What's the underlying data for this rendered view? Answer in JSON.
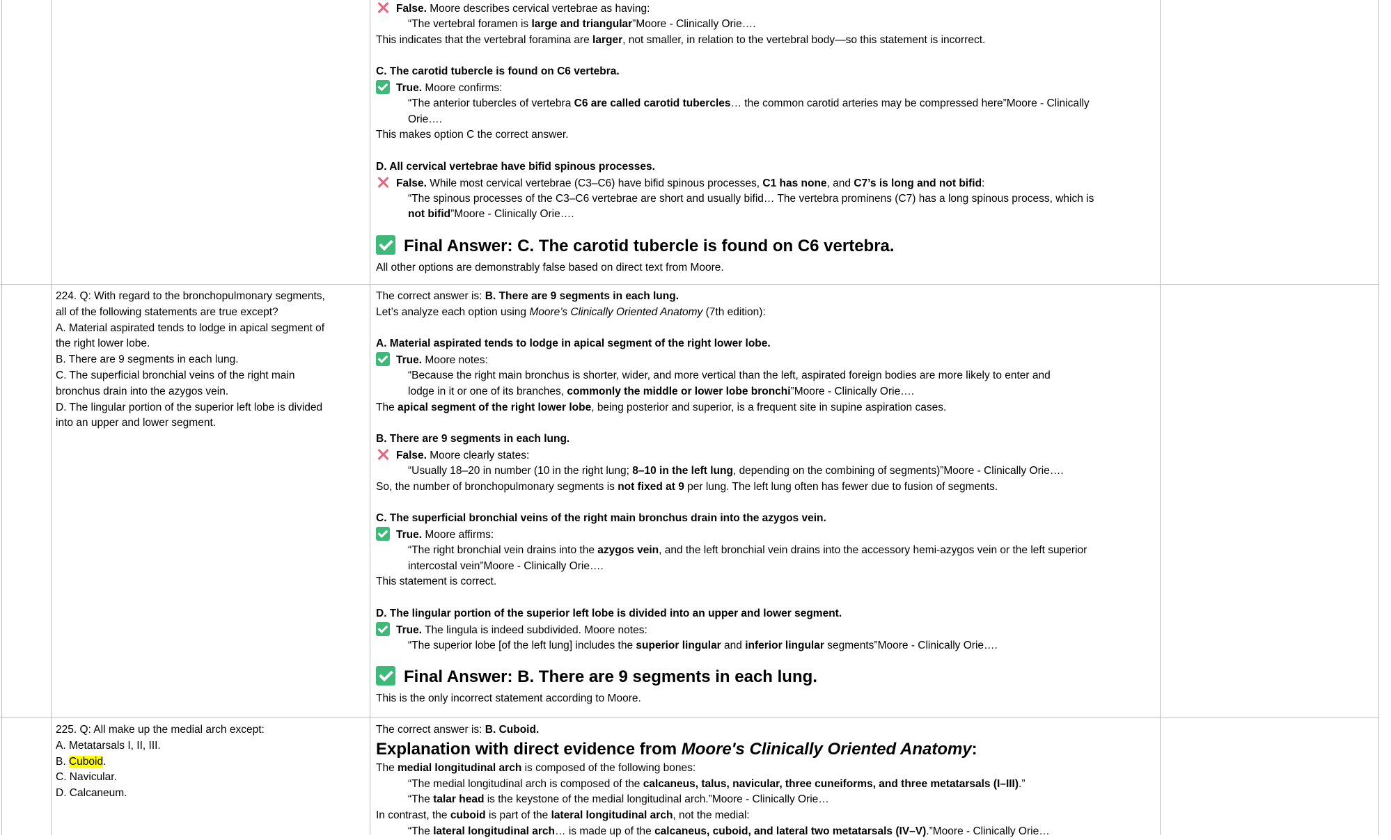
{
  "row1": {
    "d_false_prev": {
      "verdict": "False.",
      "text": " Moore describes cervical vertebrae as having:"
    },
    "quote_b_1": "“The vertebral foramen is ",
    "quote_b_2": "large and triangular",
    "quote_b_3": "”Moore - Clinically Orie….",
    "b_note_1": "This indicates that the vertebral foramina are ",
    "b_note_2": "larger",
    "b_note_3": ", not smaller, in relation to the vertebral body—so this statement is incorrect.",
    "c_head": "C. The carotid tubercle is found on C6 vertebra.",
    "c_verdict": "True.",
    "c_intro": " Moore confirms:",
    "c_quote_1": "“The anterior tubercles of vertebra ",
    "c_quote_2": "C6 are called carotid tubercles",
    "c_quote_3": "… the common carotid arteries may be compressed here”Moore - Clinically",
    "c_quote_4": "Orie….",
    "c_note": "This makes option C the correct answer.",
    "d_head": "D. All cervical vertebrae have bifid spinous processes.",
    "d_verdict": "False.",
    "d_intro_1": " While most cervical vertebrae (C3–C6) have bifid spinous processes, ",
    "d_intro_2": "C1 has none",
    "d_intro_3": ", and ",
    "d_intro_4": "C7’s is long and not bifid",
    "d_intro_5": ":",
    "d_quote_1": "“The spinous processes of the C3–C6 vertebrae are short and usually bifid… The vertebra prominens (C7) has a long spinous process, which is",
    "d_quote_2": "not bifid",
    "d_quote_3": "”Moore - Clinically Orie….",
    "final": "Final Answer: C. The carotid tubercle is found on C6 vertebra.",
    "final_note": "All other options are demonstrably false based on direct text from Moore."
  },
  "row2": {
    "question": [
      "224. Q: With regard to the bronchopulmonary segments,",
      "all of the following statements are true except?",
      "A. Material aspirated tends to lodge in apical segment of",
      "the right lower lobe.",
      "B. There are 9 segments in each lung.",
      "C. The superficial bronchial veins of the right main",
      "bronchus drain into the azygos vein.",
      "D. The lingular portion of the superior left lobe is divided",
      "into an upper and lower segment."
    ],
    "correct_1": "The correct answer is: ",
    "correct_2": "B. There are 9 segments in each lung.",
    "analyze_1": "Let’s analyze each option using ",
    "analyze_2": "Moore’s Clinically Oriented Anatomy",
    "analyze_3": " (7th edition):",
    "a_head": "A. Material aspirated tends to lodge in apical segment of the right lower lobe.",
    "a_verdict": "True.",
    "a_intro": " Moore notes:",
    "a_quote_1": "“Because the right main bronchus is shorter, wider, and more vertical than the left, aspirated foreign bodies are more likely to enter and",
    "a_quote_2": "lodge in it or one of its branches, ",
    "a_quote_3": "commonly the middle or lower lobe bronchi",
    "a_quote_4": "”Moore - Clinically Orie….",
    "a_note_1": "The ",
    "a_note_2": "apical segment of the right lower lobe",
    "a_note_3": ", being posterior and superior, is a frequent site in supine aspiration cases.",
    "b_head": "B. There are 9 segments in each lung.",
    "b_verdict": "False.",
    "b_intro": " Moore clearly states:",
    "b_quote_1": "“Usually 18–20 in number (10 in the right lung; ",
    "b_quote_2": "8–10 in the left lung",
    "b_quote_3": ", depending on the combining of segments)”Moore - Clinically Orie….",
    "b_note_1": "So, the number of bronchopulmonary segments is ",
    "b_note_2": "not fixed at 9",
    "b_note_3": " per lung. The left lung often has fewer due to fusion of segments.",
    "c_head": "C. The superficial bronchial veins of the right main bronchus drain into the azygos vein.",
    "c_verdict": "True.",
    "c_intro": " Moore affirms:",
    "c_quote_1": "“The right bronchial vein drains into the ",
    "c_quote_2": "azygos vein",
    "c_quote_3": ", and the left bronchial vein drains into the accessory hemi-azygos vein or the left superior",
    "c_quote_4": "intercostal vein”Moore - Clinically Orie….",
    "c_note": "This statement is correct.",
    "d_head": "D. The lingular portion of the superior left lobe is divided into an upper and lower segment.",
    "d_verdict": "True.",
    "d_intro": " The lingula is indeed subdivided. Moore notes:",
    "d_quote_1": "“The superior lobe [of the left lung] includes the ",
    "d_quote_2": "superior lingular",
    "d_quote_3": " and ",
    "d_quote_4": "inferior lingular",
    "d_quote_5": " segments”Moore - Clinically Orie….",
    "final": "Final Answer: B. There are 9 segments in each lung.",
    "final_note": "This is the only incorrect statement according to Moore."
  },
  "row3": {
    "q_title": "225. Q: All make up the medial arch except:",
    "q_a": "A. Metatarsals I, II, III.",
    "q_b_prefix": "B. ",
    "q_b_word": "Cuboid",
    "q_b_suffix": ".",
    "q_c": "C. Navicular.",
    "q_d": "D. Calcaneum.",
    "correct_1": "The correct answer is: ",
    "correct_2": "B. Cuboid.",
    "expl_1": "Explanation with direct evidence from ",
    "expl_2": "Moore's Clinically Oriented Anatomy",
    "expl_3": ":",
    "m_1": "The ",
    "m_2": "medial longitudinal arch",
    "m_3": " is composed of the following bones:",
    "q1_1": "“The medial longitudinal arch is composed of the ",
    "q1_2": "calcaneus, talus, navicular, three cuneiforms, and three metatarsals (I–III)",
    "q1_3": ".”",
    "q2_1": "“The ",
    "q2_2": "talar head",
    "q2_3": " is the keystone of the medial longitudinal arch.”Moore - Clinically Orie…",
    "l_1": "In contrast, the ",
    "l_2": "cuboid",
    "l_3": " is part of the ",
    "l_4": "lateral longitudinal arch",
    "l_5": ", not the medial:",
    "q3_1": "“The ",
    "q3_2": "lateral longitudinal arch",
    "q3_3": "… is made up of the ",
    "q3_4": "calcaneus, cuboid, and lateral two metatarsals (IV–V)",
    "q3_5": ".”Moore - Clinically Orie…"
  }
}
